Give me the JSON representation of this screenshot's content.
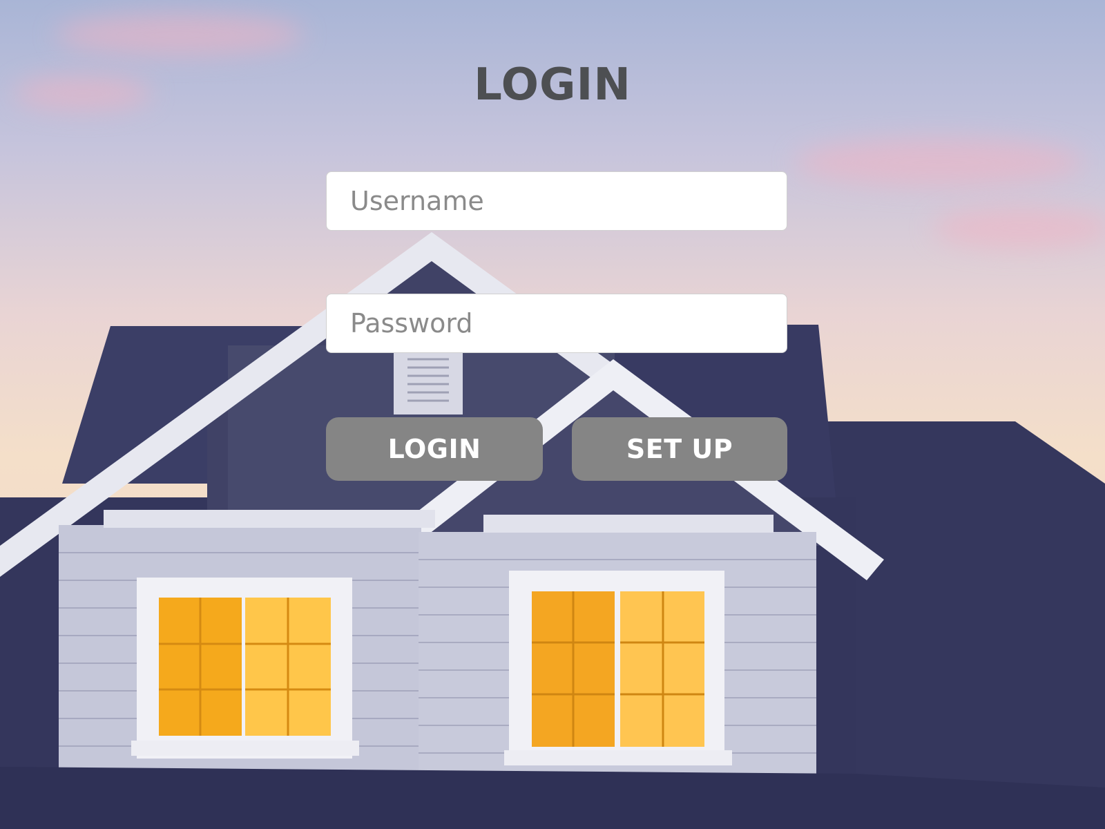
{
  "page": {
    "title": "LOGIN"
  },
  "form": {
    "username": {
      "placeholder": "Username",
      "value": ""
    },
    "password": {
      "placeholder": "Password",
      "value": ""
    }
  },
  "buttons": {
    "login_label": "LOGIN",
    "setup_label": "SET UP"
  },
  "colors": {
    "title": "#4d4f52",
    "button_bg": "#858585",
    "button_text": "#ffffff",
    "roof": "#3a3d63",
    "siding": "#c9cbdc",
    "window_light": "#f7b52a"
  }
}
